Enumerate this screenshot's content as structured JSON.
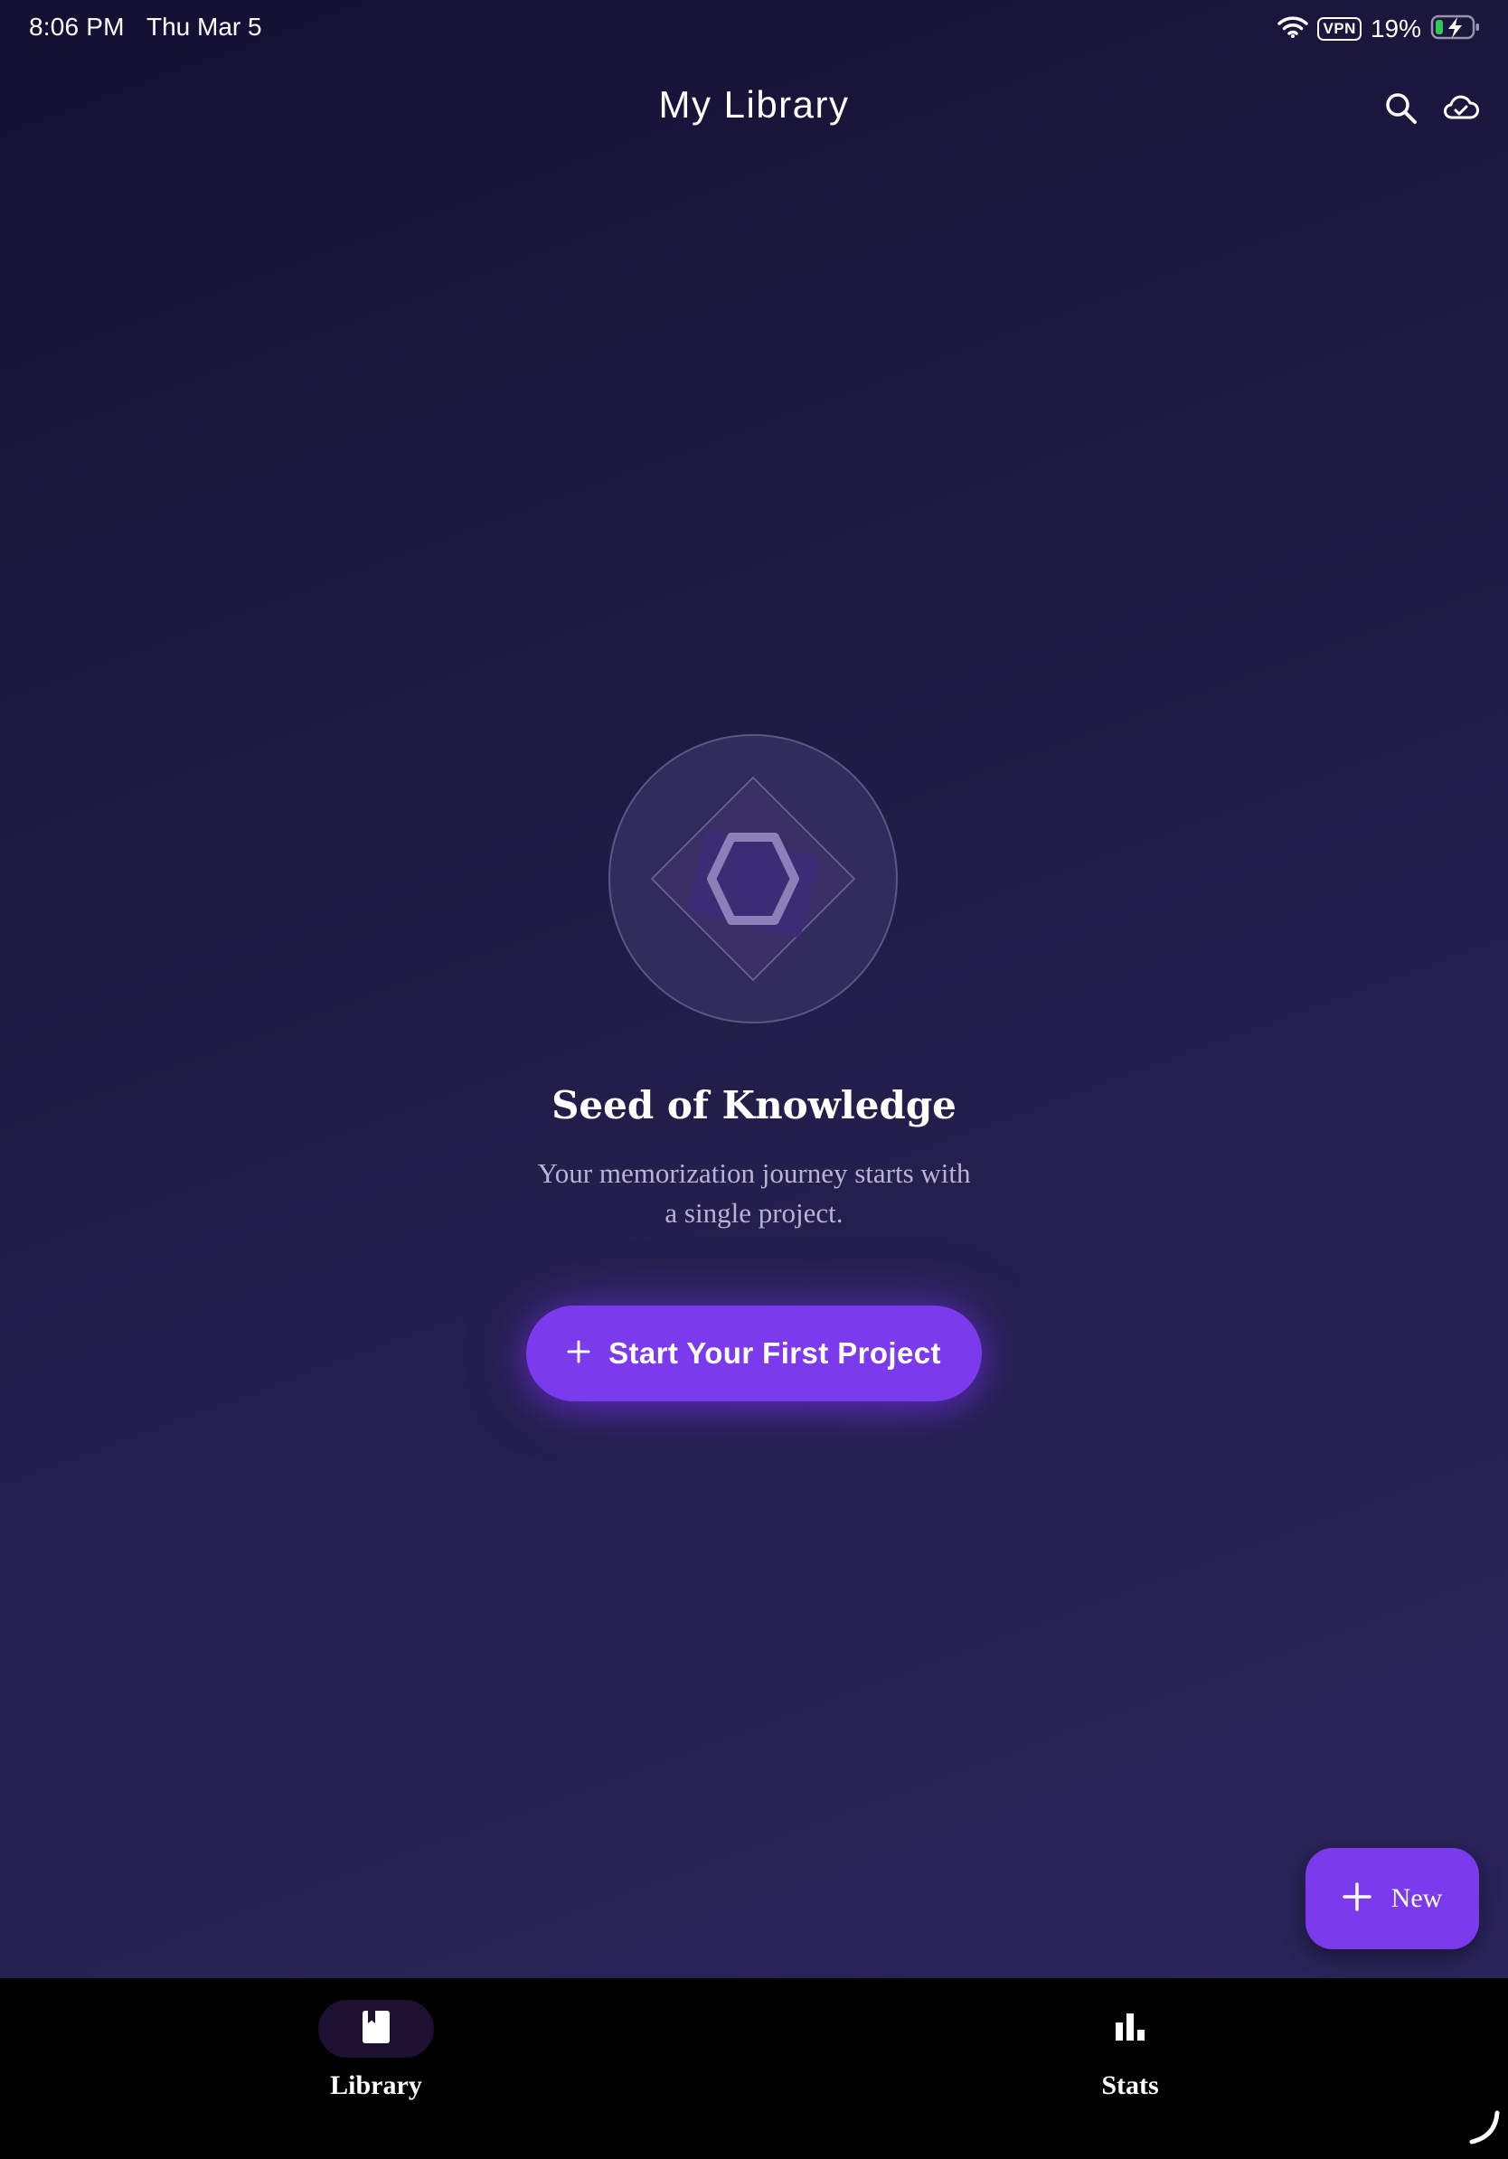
{
  "status_bar": {
    "time": "8:06 PM",
    "date": "Thu Mar 5",
    "vpn": "VPN",
    "battery": "19%",
    "icons": [
      "wifi-icon",
      "vpn-icon",
      "battery-charging-icon"
    ]
  },
  "header": {
    "title": "My Library",
    "icons": [
      "search-icon",
      "cloud-sync-icon"
    ]
  },
  "empty_state": {
    "title": "Seed of Knowledge",
    "subtitle": "Your memorization journey starts with a single project.",
    "cta_label": "Start Your First Project",
    "emblem_icon": "hexagon-diamond-emblem-icon"
  },
  "fab": {
    "label": "New",
    "icon": "plus-icon"
  },
  "bottom_nav": {
    "items": [
      {
        "label": "Library",
        "icon": "book-icon",
        "active": true
      },
      {
        "label": "Stats",
        "icon": "bar-chart-icon",
        "active": false
      }
    ]
  },
  "colors": {
    "accent": "#7c3aed",
    "background_top": "#141033",
    "background_bottom": "#2a245a",
    "subtitle": "#b9b3d6",
    "nav_background": "#000000",
    "battery_fill": "#34c759"
  }
}
